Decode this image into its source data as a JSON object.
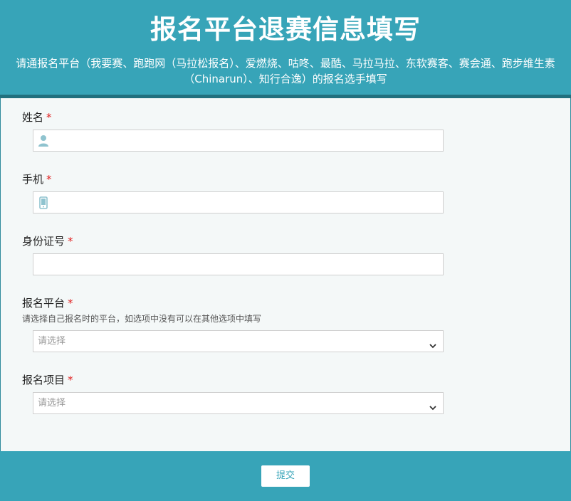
{
  "header": {
    "title": "报名平台退赛信息填写",
    "subtitle": "请通报名平台（我要赛、跑跑网（马拉松报名）、爱燃烧、咕咚、最酷、马拉马拉、东软赛客、赛会通、跑步维生素（Chinarun）、知行合逸）的报名选手填写"
  },
  "form": {
    "required_mark": "*",
    "name": {
      "label": "姓名",
      "value": "",
      "icon": "user-icon"
    },
    "phone": {
      "label": "手机",
      "value": "",
      "icon": "phone-icon"
    },
    "id_number": {
      "label": "身份证号",
      "value": ""
    },
    "platform": {
      "label": "报名平台",
      "hint": "请选择自己报名时的平台，如选项中没有可以在其他选项中填写",
      "placeholder": "请选择"
    },
    "event": {
      "label": "报名项目",
      "placeholder": "请选择"
    }
  },
  "footer": {
    "submit_label": "提交"
  },
  "colors": {
    "accent": "#37a4b8",
    "accent_dark": "#21707e",
    "required": "#e02020"
  }
}
